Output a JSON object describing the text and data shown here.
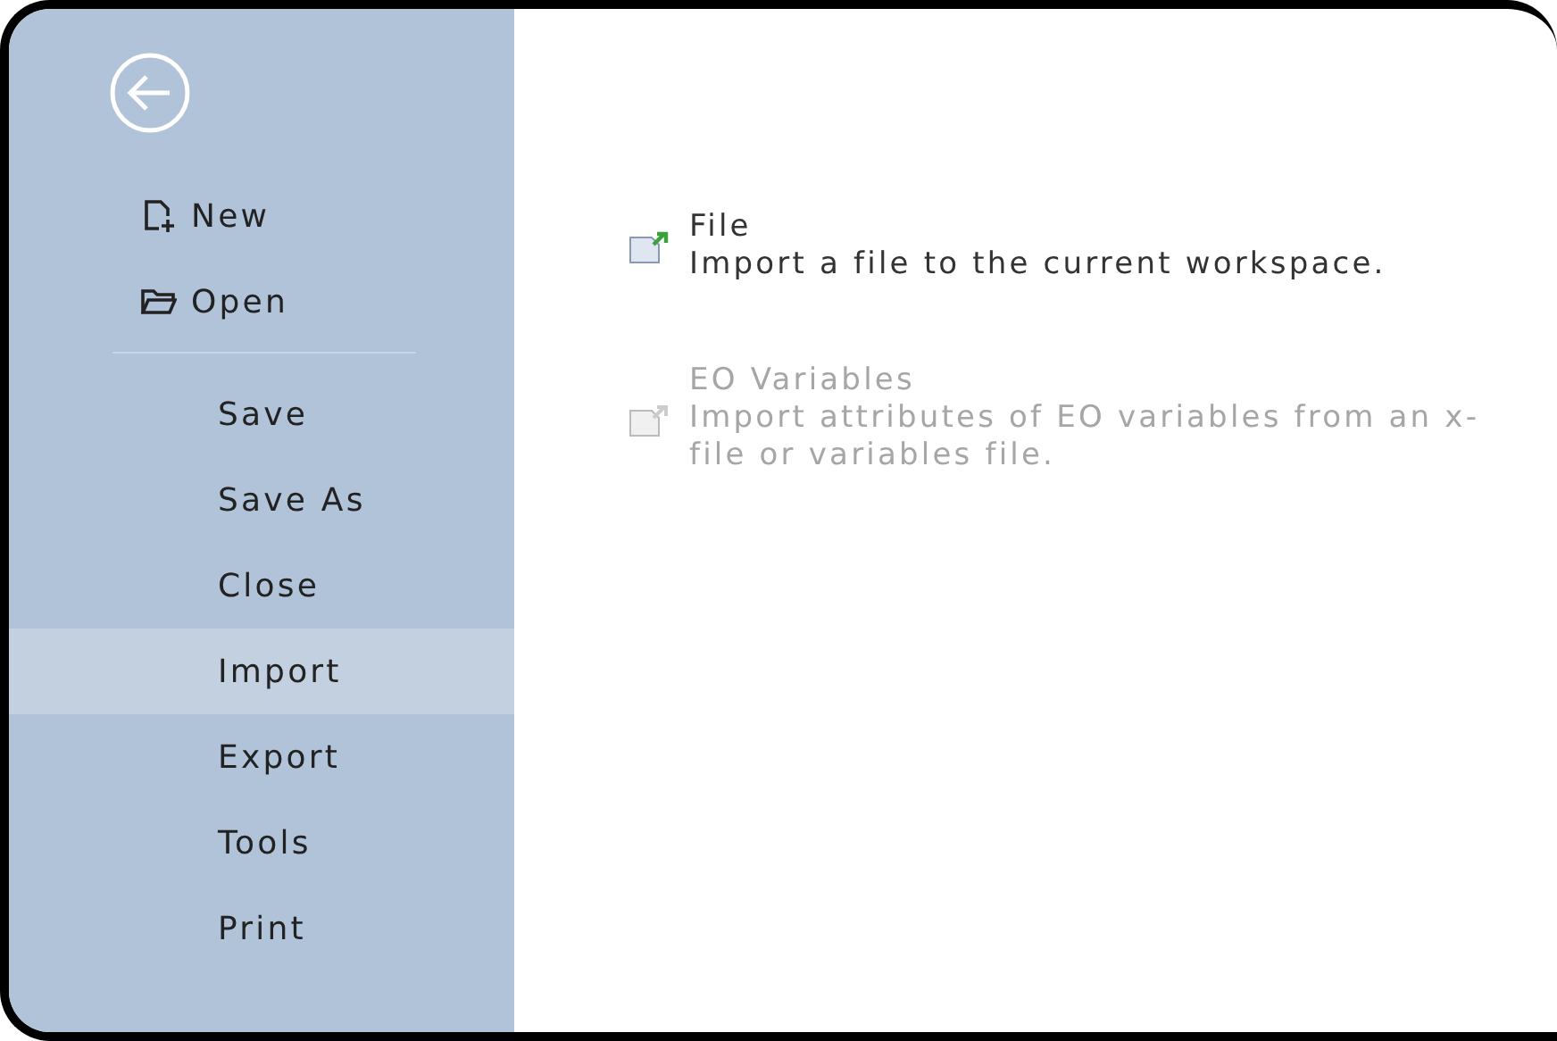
{
  "sidebar": {
    "file_items": [
      {
        "label": "New",
        "selected": false
      },
      {
        "label": "Open",
        "selected": false
      }
    ],
    "items": [
      {
        "label": "Save",
        "selected": false
      },
      {
        "label": "Save As",
        "selected": false
      },
      {
        "label": "Close",
        "selected": false
      },
      {
        "label": "Import",
        "selected": true
      },
      {
        "label": "Export",
        "selected": false
      },
      {
        "label": "Tools",
        "selected": false
      },
      {
        "label": "Print",
        "selected": false
      }
    ]
  },
  "import_options": [
    {
      "kind": "file",
      "title": "File",
      "description": "Import a file to the current workspace.",
      "disabled": false
    },
    {
      "kind": "variables",
      "title": "EO Variables",
      "description": "Import attributes of EO variables from an x-file or variables file.",
      "disabled": true
    }
  ]
}
